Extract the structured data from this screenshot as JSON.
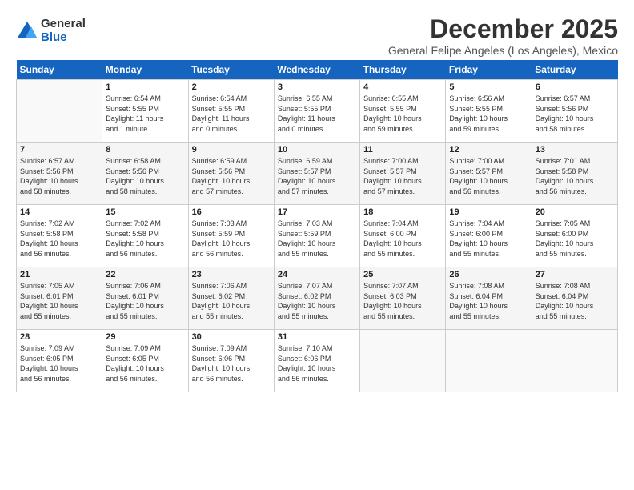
{
  "logo": {
    "general": "General",
    "blue": "Blue"
  },
  "title": "December 2025",
  "subtitle": "General Felipe Angeles (Los Angeles), Mexico",
  "headers": [
    "Sunday",
    "Monday",
    "Tuesday",
    "Wednesday",
    "Thursday",
    "Friday",
    "Saturday"
  ],
  "weeks": [
    [
      {
        "num": "",
        "info": ""
      },
      {
        "num": "1",
        "info": "Sunrise: 6:54 AM\nSunset: 5:55 PM\nDaylight: 11 hours\nand 1 minute."
      },
      {
        "num": "2",
        "info": "Sunrise: 6:54 AM\nSunset: 5:55 PM\nDaylight: 11 hours\nand 0 minutes."
      },
      {
        "num": "3",
        "info": "Sunrise: 6:55 AM\nSunset: 5:55 PM\nDaylight: 11 hours\nand 0 minutes."
      },
      {
        "num": "4",
        "info": "Sunrise: 6:55 AM\nSunset: 5:55 PM\nDaylight: 10 hours\nand 59 minutes."
      },
      {
        "num": "5",
        "info": "Sunrise: 6:56 AM\nSunset: 5:55 PM\nDaylight: 10 hours\nand 59 minutes."
      },
      {
        "num": "6",
        "info": "Sunrise: 6:57 AM\nSunset: 5:56 PM\nDaylight: 10 hours\nand 58 minutes."
      }
    ],
    [
      {
        "num": "7",
        "info": "Sunrise: 6:57 AM\nSunset: 5:56 PM\nDaylight: 10 hours\nand 58 minutes."
      },
      {
        "num": "8",
        "info": "Sunrise: 6:58 AM\nSunset: 5:56 PM\nDaylight: 10 hours\nand 58 minutes."
      },
      {
        "num": "9",
        "info": "Sunrise: 6:59 AM\nSunset: 5:56 PM\nDaylight: 10 hours\nand 57 minutes."
      },
      {
        "num": "10",
        "info": "Sunrise: 6:59 AM\nSunset: 5:57 PM\nDaylight: 10 hours\nand 57 minutes."
      },
      {
        "num": "11",
        "info": "Sunrise: 7:00 AM\nSunset: 5:57 PM\nDaylight: 10 hours\nand 57 minutes."
      },
      {
        "num": "12",
        "info": "Sunrise: 7:00 AM\nSunset: 5:57 PM\nDaylight: 10 hours\nand 56 minutes."
      },
      {
        "num": "13",
        "info": "Sunrise: 7:01 AM\nSunset: 5:58 PM\nDaylight: 10 hours\nand 56 minutes."
      }
    ],
    [
      {
        "num": "14",
        "info": "Sunrise: 7:02 AM\nSunset: 5:58 PM\nDaylight: 10 hours\nand 56 minutes."
      },
      {
        "num": "15",
        "info": "Sunrise: 7:02 AM\nSunset: 5:58 PM\nDaylight: 10 hours\nand 56 minutes."
      },
      {
        "num": "16",
        "info": "Sunrise: 7:03 AM\nSunset: 5:59 PM\nDaylight: 10 hours\nand 56 minutes."
      },
      {
        "num": "17",
        "info": "Sunrise: 7:03 AM\nSunset: 5:59 PM\nDaylight: 10 hours\nand 55 minutes."
      },
      {
        "num": "18",
        "info": "Sunrise: 7:04 AM\nSunset: 6:00 PM\nDaylight: 10 hours\nand 55 minutes."
      },
      {
        "num": "19",
        "info": "Sunrise: 7:04 AM\nSunset: 6:00 PM\nDaylight: 10 hours\nand 55 minutes."
      },
      {
        "num": "20",
        "info": "Sunrise: 7:05 AM\nSunset: 6:00 PM\nDaylight: 10 hours\nand 55 minutes."
      }
    ],
    [
      {
        "num": "21",
        "info": "Sunrise: 7:05 AM\nSunset: 6:01 PM\nDaylight: 10 hours\nand 55 minutes."
      },
      {
        "num": "22",
        "info": "Sunrise: 7:06 AM\nSunset: 6:01 PM\nDaylight: 10 hours\nand 55 minutes."
      },
      {
        "num": "23",
        "info": "Sunrise: 7:06 AM\nSunset: 6:02 PM\nDaylight: 10 hours\nand 55 minutes."
      },
      {
        "num": "24",
        "info": "Sunrise: 7:07 AM\nSunset: 6:02 PM\nDaylight: 10 hours\nand 55 minutes."
      },
      {
        "num": "25",
        "info": "Sunrise: 7:07 AM\nSunset: 6:03 PM\nDaylight: 10 hours\nand 55 minutes."
      },
      {
        "num": "26",
        "info": "Sunrise: 7:08 AM\nSunset: 6:04 PM\nDaylight: 10 hours\nand 55 minutes."
      },
      {
        "num": "27",
        "info": "Sunrise: 7:08 AM\nSunset: 6:04 PM\nDaylight: 10 hours\nand 55 minutes."
      }
    ],
    [
      {
        "num": "28",
        "info": "Sunrise: 7:09 AM\nSunset: 6:05 PM\nDaylight: 10 hours\nand 56 minutes."
      },
      {
        "num": "29",
        "info": "Sunrise: 7:09 AM\nSunset: 6:05 PM\nDaylight: 10 hours\nand 56 minutes."
      },
      {
        "num": "30",
        "info": "Sunrise: 7:09 AM\nSunset: 6:06 PM\nDaylight: 10 hours\nand 56 minutes."
      },
      {
        "num": "31",
        "info": "Sunrise: 7:10 AM\nSunset: 6:06 PM\nDaylight: 10 hours\nand 56 minutes."
      },
      {
        "num": "",
        "info": ""
      },
      {
        "num": "",
        "info": ""
      },
      {
        "num": "",
        "info": ""
      }
    ]
  ]
}
